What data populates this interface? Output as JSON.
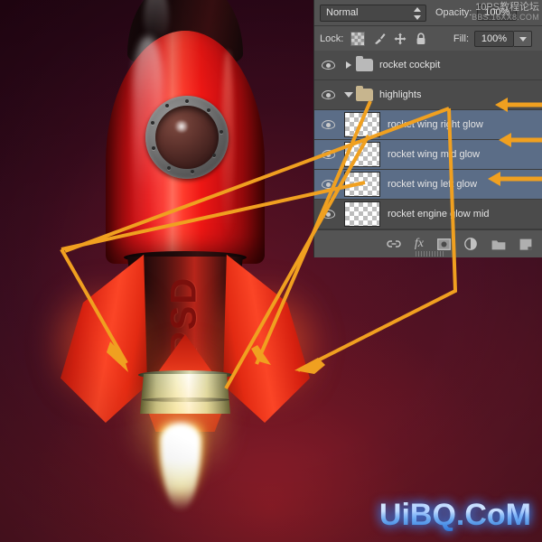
{
  "app": {
    "watermark_canvas": "UiBQ.CoM",
    "watermark_panel_line1": "10PS教程论坛",
    "watermark_panel_line2": "BBS.16XX8.COM"
  },
  "artwork": {
    "body_text": "PSD",
    "description": "red rocket with porthole, three fins and engine flame"
  },
  "panel": {
    "blend_mode": {
      "value": "Normal",
      "spinner_up_icon": "chevron-up-icon",
      "spinner_down_icon": "chevron-down-icon"
    },
    "opacity": {
      "label": "Opacity:",
      "value": "100%"
    },
    "lock": {
      "label": "Lock:",
      "icons": [
        "lock-transparent-pixels-icon",
        "lock-image-pixels-icon",
        "lock-position-icon",
        "lock-all-icon"
      ]
    },
    "fill": {
      "label": "Fill:",
      "value": "100%",
      "arrow_icon": "chevron-down-icon"
    },
    "layers": [
      {
        "name": "rocket cockpit",
        "type": "group",
        "expanded": false,
        "selected": false,
        "visible": true,
        "eye_icon": "eye-icon",
        "disclosure_icon": "chevron-right-icon",
        "folder_icon": "folder-closed-icon"
      },
      {
        "name": "highlights",
        "type": "group",
        "expanded": true,
        "selected": false,
        "visible": true,
        "eye_icon": "eye-icon",
        "disclosure_icon": "chevron-down-icon",
        "folder_icon": "folder-open-icon"
      },
      {
        "name": "rocket wing right glow",
        "type": "layer",
        "selected": true,
        "visible": true,
        "eye_icon": "eye-icon",
        "thumbnail": "transparent-checker-thumbnail"
      },
      {
        "name": "rocket wing mid glow",
        "type": "layer",
        "selected": true,
        "visible": true,
        "eye_icon": "eye-icon",
        "thumbnail": "transparent-checker-thumbnail"
      },
      {
        "name": "rocket wing left glow",
        "type": "layer",
        "selected": true,
        "visible": true,
        "eye_icon": "eye-icon",
        "thumbnail": "transparent-checker-thumbnail"
      },
      {
        "name": "rocket engine glow mid",
        "type": "layer",
        "selected": false,
        "visible": true,
        "eye_icon": "eye-icon",
        "thumbnail": "transparent-checker-thumbnail"
      }
    ],
    "bottom_bar_icons": [
      {
        "name": "link-layers-icon",
        "glyph": "⚭"
      },
      {
        "name": "layer-style-fx-icon",
        "glyph": "fx"
      },
      {
        "name": "add-layer-mask-icon",
        "glyph": "▣"
      },
      {
        "name": "adjustment-layer-icon",
        "glyph": "◑"
      },
      {
        "name": "new-group-icon",
        "glyph": "▰"
      },
      {
        "name": "new-layer-icon",
        "glyph": "◨"
      }
    ]
  },
  "annotations": {
    "arrow_color": "#f0a020",
    "arrows": [
      {
        "name": "arrow-to-left-wing",
        "target": "rocket left wing"
      },
      {
        "name": "arrow-to-mid-wing",
        "target": "rocket mid wing"
      },
      {
        "name": "arrow-to-right-wing",
        "target": "rocket right wing"
      },
      {
        "name": "arrow-to-layer-right-glow",
        "target": "rocket wing right glow layer row"
      },
      {
        "name": "arrow-to-layer-mid-glow",
        "target": "rocket wing mid glow layer row"
      },
      {
        "name": "arrow-to-layer-left-glow",
        "target": "rocket wing left glow layer row"
      }
    ]
  },
  "colors": {
    "accent_arrow": "#f0a020",
    "panel_bg": "#535353",
    "layer_selected": "#5b6d87",
    "rocket_red": "#e8191a",
    "background_maroon": "#431026"
  }
}
